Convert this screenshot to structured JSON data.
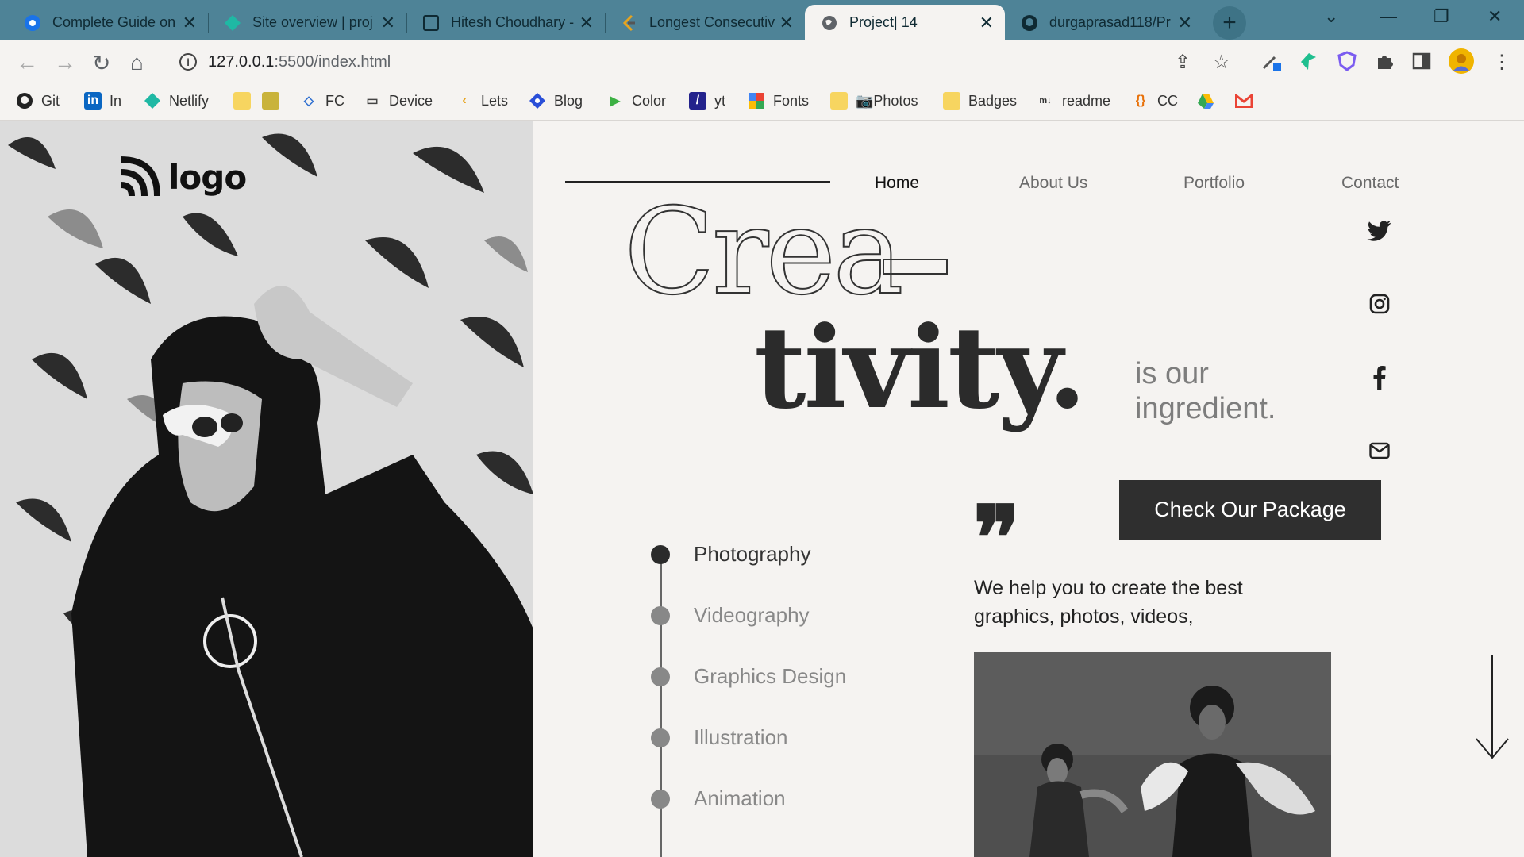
{
  "browser": {
    "tabs": [
      {
        "title": "Complete Guide on",
        "icon": "blue-circle-icon"
      },
      {
        "title": "Site overview | proj",
        "icon": "netlify-icon"
      },
      {
        "title": "Hitesh Choudhary -",
        "icon": "square-icon"
      },
      {
        "title": "Longest Consecutiv",
        "icon": "leetcode-icon"
      },
      {
        "title": "Project| 14",
        "icon": "globe-icon"
      },
      {
        "title": "durgaprasad118/Pr",
        "icon": "github-icon"
      }
    ],
    "new_tab": "+",
    "url_host": "127.0.0.1",
    "url_rest": ":5500/index.html",
    "bookmarks": [
      {
        "label": "Git",
        "icon": "github-icon"
      },
      {
        "label": "In",
        "icon": "linkedin-icon"
      },
      {
        "label": "Netlify",
        "icon": "netlify-icon"
      },
      {
        "label": "",
        "icon": "folder-icon"
      },
      {
        "label": "",
        "icon": "extension-icon"
      },
      {
        "label": "FC",
        "icon": "code-icon"
      },
      {
        "label": "Device",
        "icon": "device-icon"
      },
      {
        "label": "Lets",
        "icon": "leetcode-icon"
      },
      {
        "label": "Blog",
        "icon": "blog-icon"
      },
      {
        "label": "Color",
        "icon": "color-icon"
      },
      {
        "label": "yt",
        "icon": "yt-icon"
      },
      {
        "label": "Fonts",
        "icon": "fonts-icon"
      },
      {
        "label": "📷Photos",
        "icon": "folder-icon"
      },
      {
        "label": "Badges",
        "icon": "folder-icon"
      },
      {
        "label": "readme",
        "icon": "readme-icon"
      },
      {
        "label": "CC",
        "icon": "braces-icon"
      },
      {
        "label": "",
        "icon": "drive-icon"
      },
      {
        "label": "",
        "icon": "gmail-icon"
      }
    ]
  },
  "site": {
    "logo": "logo",
    "nav": [
      "Home",
      "About Us",
      "Portfolio",
      "Contact"
    ],
    "headline_outline": "Crea",
    "headline_bold": "tivity.",
    "tagline": "is our ingredient.",
    "cta": "Check Our Package",
    "services": [
      "Photography",
      "Videography",
      "Graphics Design",
      "Illustration",
      "Animation"
    ],
    "quote": "We help you to create the best graphics, photos, videos,",
    "social": [
      "twitter-icon",
      "instagram-icon",
      "facebook-icon",
      "mail-icon"
    ]
  }
}
